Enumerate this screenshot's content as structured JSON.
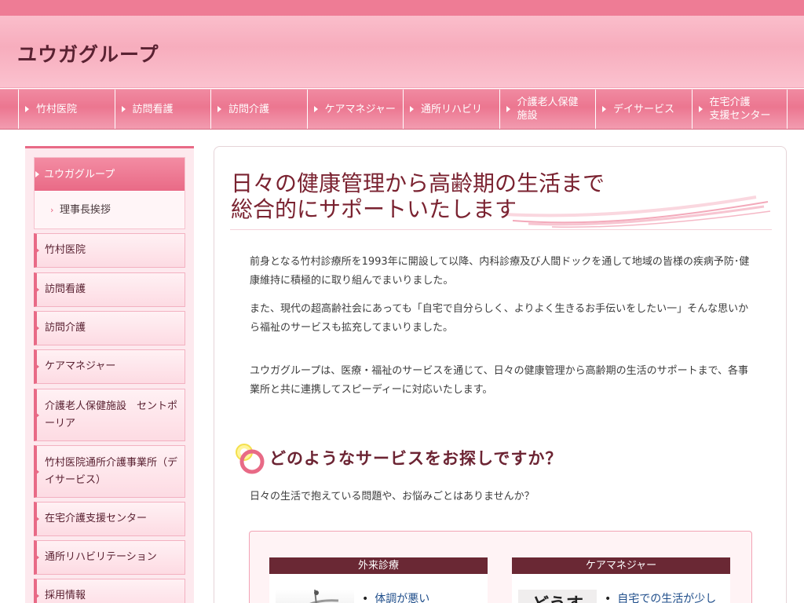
{
  "header": {
    "site_title": "ユウガグループ"
  },
  "nav": {
    "items": [
      {
        "label": "竹村医院"
      },
      {
        "label": "訪問看護"
      },
      {
        "label": "訪問介護"
      },
      {
        "label": "ケアマネジャー"
      },
      {
        "label": "通所リハビリ"
      },
      {
        "label": "介護老人保健\n施設"
      },
      {
        "label": "デイサービス"
      },
      {
        "label": "在宅介護\n支援センター"
      }
    ]
  },
  "sidebar": {
    "active_label": "ユウガグループ",
    "sub_label": "理事長挨拶",
    "items": [
      {
        "label": "竹村医院"
      },
      {
        "label": "訪問看護"
      },
      {
        "label": "訪問介護"
      },
      {
        "label": "ケアマネジャー"
      },
      {
        "label": "介護老人保健施設　セントポーリア"
      },
      {
        "label": "竹村医院通所介護事業所（デイサービス）"
      },
      {
        "label": "在宅介護支援センター"
      },
      {
        "label": "通所リハビリテーション"
      },
      {
        "label": "採用情報"
      }
    ]
  },
  "main": {
    "heading_line1": "日々の健康管理から高齢期の生活まで",
    "heading_line2": "総合的にサポートいたします",
    "para1": "前身となる竹村診療所を1993年に開設して以降、内科診療及び人間ドックを通して地域の皆様の疾病予防･健康維持に積極的に取り組んでまいりました。",
    "para2": "また、現代の超高齢社会にあっても「自宅で自分らしく、よりよく生きるお手伝いをしたい一」そんな思いから福祉のサービスも拡充してまいりました。",
    "para3": "ユウガグループは、医療・福祉のサービスを通じて、日々の健康管理から高齢期の生活のサポートまで、各事業所と共に連携してスピーディーに対応いたします。",
    "question_heading": "どのようなサービスをお探しですか？",
    "question_text": "日々の生活で抱えている問題や、お悩みごとはありませんか？",
    "cards": [
      {
        "title": "外来診療",
        "bullet": "体調が悪い"
      },
      {
        "title": "ケアマネジャー",
        "bullet": "自宅での生活が少し",
        "image_text": "どうする？"
      }
    ]
  },
  "colors": {
    "accent_pink": "#e86a86",
    "dark_maroon": "#6a2834",
    "heading_red": "#7a2230"
  }
}
